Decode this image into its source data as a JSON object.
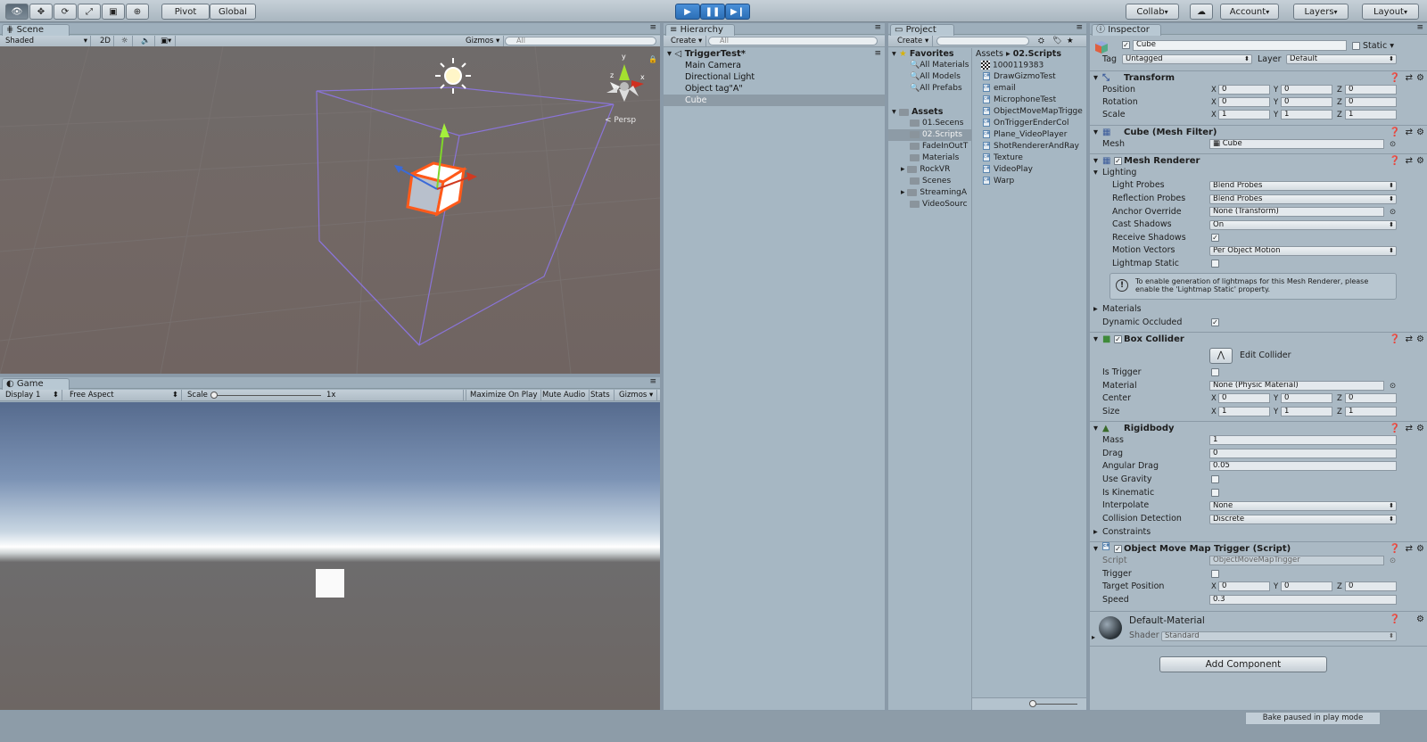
{
  "toolbar": {
    "pivot": "Pivot",
    "global": "Global",
    "collab": "Collab",
    "account": "Account",
    "layers": "Layers",
    "layout": "Layout"
  },
  "scene": {
    "tab": "Scene",
    "shading": "Shaded",
    "mode2d": "2D",
    "gizmos": "Gizmos",
    "search_placeholder": "All",
    "persp": "< Persp",
    "axis_x": "x",
    "axis_y": "y",
    "axis_z": "z"
  },
  "game": {
    "tab": "Game",
    "display": "Display 1",
    "aspect": "Free Aspect",
    "scale_label": "Scale",
    "scale_value": "1x",
    "maximize": "Maximize On Play",
    "mute": "Mute Audio",
    "stats": "Stats",
    "gizmos": "Gizmos"
  },
  "hierarchy": {
    "tab": "Hierarchy",
    "create": "Create",
    "search_placeholder": "All",
    "scene_name": "TriggerTest*",
    "items": [
      "Main Camera",
      "Directional Light",
      "Object tag\"A\"",
      "Cube"
    ]
  },
  "project": {
    "tab": "Project",
    "create": "Create",
    "favorites": "Favorites",
    "fav_items": [
      "All Materials",
      "All Models",
      "All Prefabs"
    ],
    "assets": "Assets",
    "folders": [
      "01.Secens",
      "02.Scripts",
      "FadeInOutT",
      "Materials",
      "RockVR",
      "Scenes",
      "StreamingA",
      "VideoSourc"
    ],
    "breadcrumb_root": "Assets",
    "breadcrumb_sep": "▸",
    "breadcrumb_current": "02.Scripts",
    "files": [
      "1000119383",
      "DrawGizmoTest",
      "email",
      "MicrophoneTest",
      "ObjectMoveMapTrigge",
      "OnTriggerEnderCol",
      "Plane_VideoPlayer",
      "ShotRendererAndRay",
      "Texture",
      "VideoPlay",
      "Warp"
    ]
  },
  "inspector": {
    "tab": "Inspector",
    "object_name": "Cube",
    "static": "Static",
    "tag_label": "Tag",
    "tag": "Untagged",
    "layer_label": "Layer",
    "layer": "Default",
    "transform": {
      "title": "Transform",
      "position": "Position",
      "rotation": "Rotation",
      "scale": "Scale",
      "pos": [
        "0",
        "0",
        "0"
      ],
      "rot": [
        "0",
        "0",
        "0"
      ],
      "scl": [
        "1",
        "1",
        "1"
      ]
    },
    "mesh_filter": {
      "title": "Cube (Mesh Filter)",
      "mesh_label": "Mesh",
      "mesh": "Cube"
    },
    "mesh_renderer": {
      "title": "Mesh Renderer",
      "lighting": "Lighting",
      "light_probes_label": "Light Probes",
      "light_probes": "Blend Probes",
      "reflection_probes_label": "Reflection Probes",
      "reflection_probes": "Blend Probes",
      "anchor_label": "Anchor Override",
      "anchor": "None (Transform)",
      "cast_label": "Cast Shadows",
      "cast": "On",
      "receive_label": "Receive Shadows",
      "motion_label": "Motion Vectors",
      "motion": "Per Object Motion",
      "lightmap_label": "Lightmap Static",
      "info": "To enable generation of lightmaps for this Mesh Renderer, please enable the 'Lightmap Static' property.",
      "materials": "Materials",
      "dynamic_label": "Dynamic Occluded"
    },
    "box_collider": {
      "title": "Box Collider",
      "edit": "Edit Collider",
      "trigger_label": "Is Trigger",
      "material_label": "Material",
      "material": "None (Physic Material)",
      "center_label": "Center",
      "center": [
        "0",
        "0",
        "0"
      ],
      "size_label": "Size",
      "size": [
        "1",
        "1",
        "1"
      ]
    },
    "rigidbody": {
      "title": "Rigidbody",
      "mass_label": "Mass",
      "mass": "1",
      "drag_label": "Drag",
      "drag": "0",
      "angular_label": "Angular Drag",
      "angular": "0.05",
      "gravity_label": "Use Gravity",
      "kinematic_label": "Is Kinematic",
      "interpolate_label": "Interpolate",
      "interpolate": "None",
      "collision_label": "Collision Detection",
      "collision": "Discrete",
      "constraints": "Constraints"
    },
    "script": {
      "title": "Object Move Map Trigger (Script)",
      "script_label": "Script",
      "script": "ObjectMoveMapTrigger",
      "trigger_label": "Trigger",
      "target_label": "Target Position",
      "target": [
        "0",
        "0",
        "0"
      ],
      "speed_label": "Speed",
      "speed": "0.3"
    },
    "material": {
      "name": "Default-Material",
      "shader_label": "Shader",
      "shader": "Standard"
    },
    "add_component": "Add Component"
  },
  "status": {
    "bake": "Bake paused in play mode"
  }
}
